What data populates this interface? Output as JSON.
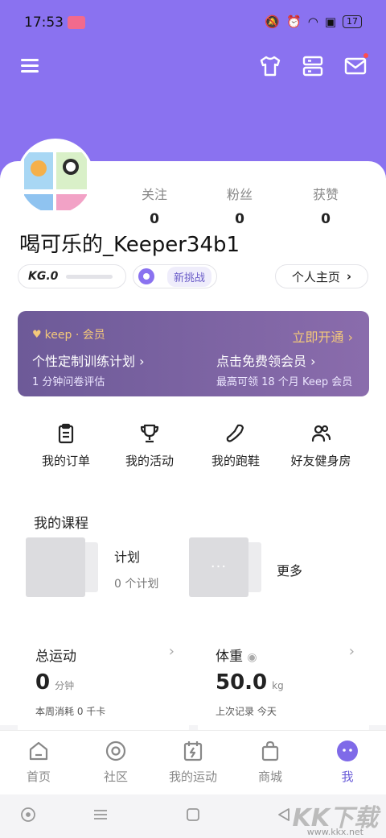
{
  "status": {
    "time": "17:53",
    "battery": "17"
  },
  "header": {
    "icons": [
      "menu-icon",
      "shirt-icon",
      "server-icon",
      "mail-icon"
    ]
  },
  "profile": {
    "username": "喝可乐的_Keeper34b1",
    "stats": [
      {
        "label": "关注",
        "value": "0"
      },
      {
        "label": "粉丝",
        "value": "0"
      },
      {
        "label": "获赞",
        "value": "0"
      }
    ],
    "kg_level": "KG.0",
    "kg_progress": 0,
    "challenge_label": "新挑战",
    "home_button": "个人主页"
  },
  "vip": {
    "logo_text": "keep · 会员",
    "open_label": "立即开通",
    "items": [
      {
        "title": "个性定制训练计划",
        "sub": "1 分钟问卷评估"
      },
      {
        "title": "点击免费领会员",
        "sub": "最高可领 18 个月 Keep 会员"
      }
    ],
    "colors": {
      "gold": "#f4c97a",
      "purple": "#6d5a98"
    }
  },
  "quick": [
    {
      "label": "我的订单",
      "icon": "clipboard-icon"
    },
    {
      "label": "我的活动",
      "icon": "trophy-icon"
    },
    {
      "label": "我的跑鞋",
      "icon": "shoe-icon"
    },
    {
      "label": "好友健身房",
      "icon": "friends-icon"
    }
  ],
  "courses": {
    "title": "我的课程",
    "plan_label": "计划",
    "plan_sub": "0 个计划",
    "more_label": "更多",
    "more_dots": "···"
  },
  "cards": [
    {
      "title": "总运动",
      "value": "0",
      "unit": "分钟",
      "sub": "本周消耗 0 千卡"
    },
    {
      "title": "体重",
      "value": "50.0",
      "unit": "kg",
      "sub": "上次记录 今天"
    }
  ],
  "tabs": [
    {
      "label": "首页",
      "icon": "home-icon",
      "active": false
    },
    {
      "label": "社区",
      "icon": "community-icon",
      "active": false
    },
    {
      "label": "我的运动",
      "icon": "calendar-icon",
      "active": false
    },
    {
      "label": "商城",
      "icon": "shop-bag-icon",
      "active": false
    },
    {
      "label": "我",
      "icon": "me-icon",
      "active": true
    }
  ],
  "watermark": {
    "text": "KK下载",
    "url": "www.kkx.net"
  },
  "accent": "#8a72f0"
}
